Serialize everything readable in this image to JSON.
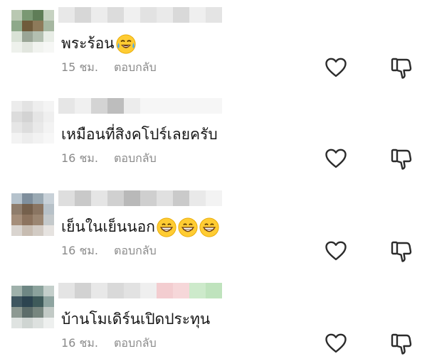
{
  "comments": [
    {
      "author": "",
      "text": "พระร้อน",
      "emoji": [
        "tears-of-joy-emoji"
      ],
      "time": "15 ชม.",
      "reply_label": "ตอบกลับ",
      "avatar_colors": [
        "#b9c8b2",
        "#7a9873",
        "#5f7d57",
        "#c6d2c1",
        "#8ea98a",
        "#6f5b3b",
        "#8d7a5a",
        "#a6b7a1",
        "#d9e2d6",
        "#9aa596",
        "#b3bfb0",
        "#e8ede6",
        "#eef1ec",
        "#e2e6df",
        "#f1f3ef",
        "#f6f7f5"
      ],
      "name_blur": [
        "#e8e8e8",
        "#d7d7d7",
        "#ececec",
        "#dcdcdc",
        "#f0f0f0",
        "#e2e2e2",
        "#eaeaea",
        "#d9d9d9",
        "#efefef",
        "#e4e4e4"
      ]
    },
    {
      "author": "",
      "text": "เหมือนที่สิงคโปร์เลยครับ",
      "emoji": [],
      "time": "16 ชม.",
      "reply_label": "ตอบกลับ",
      "avatar_colors": [
        "#ececec",
        "#e3e3e3",
        "#eeeeee",
        "#f4f4f4",
        "#dcdcdc",
        "#d3d3d3",
        "#e5e5e5",
        "#efefef",
        "#e6e6e6",
        "#dddddd",
        "#e9e9e9",
        "#f3f3f3",
        "#f3f3f3",
        "#ededed",
        "#f2f2f2",
        "#f7f7f7"
      ],
      "name_blur": [
        "#e6e6e6",
        "#f0f0f0",
        "#d4d4d4",
        "#bdbdbd",
        "#ececec",
        "#f6f6f6",
        "#f6f6f6",
        "#f6f6f6",
        "#f6f6f6",
        "#f6f6f6"
      ]
    },
    {
      "author": "",
      "text": "เย็นในเย็นนอก",
      "emoji": [
        "grinning-emoji",
        "grinning-emoji",
        "grinning-emoji"
      ],
      "time": "16 ชม.",
      "reply_label": "ตอบกลับ",
      "avatar_colors": [
        "#b5c2cc",
        "#7f8f9d",
        "#9aa9b3",
        "#c8d1d8",
        "#8f7d6c",
        "#75604c",
        "#8a7562",
        "#b7c1c8",
        "#a58e7a",
        "#8c735e",
        "#9b8672",
        "#c4c9cb",
        "#d9d4cf",
        "#c7bcb1",
        "#d2cbc4",
        "#e6e3e0"
      ],
      "name_blur": [
        "#dedede",
        "#c9c9c9",
        "#e5e5e5",
        "#d0d0d0",
        "#b9b9b9",
        "#cfcfcf",
        "#e0e0e0",
        "#cacaca",
        "#e9e9e9",
        "#f3f3f3"
      ]
    },
    {
      "author": "",
      "text": "บ้านโมเดิร์นเปิดประทุน",
      "emoji": [],
      "time": "16 ชม.",
      "reply_label": "ตอบกลับ",
      "avatar_colors": [
        "#9fb1ab",
        "#6e8784",
        "#8ba29c",
        "#c4cfcb",
        "#3f5660",
        "#2c4450",
        "#3e5a5a",
        "#8ea4a0",
        "#8d9992",
        "#5d6d6a",
        "#77867f",
        "#c2cac6",
        "#dfe3e1",
        "#cfd5d2",
        "#dde1df",
        "#eef0ef"
      ],
      "name_blur": [
        "#e4e4e4",
        "#d2d2d2",
        "#e8e8e8",
        "#d9d9d9",
        "#e2e2e2",
        "#efefef",
        "#f3cdd0",
        "#f6d7d9",
        "#cdeacb",
        "#bfe3bd"
      ]
    }
  ],
  "colors": {
    "text": "#161616",
    "meta": "#8a8a8a",
    "icon": "#2b2b2b"
  },
  "icons": {
    "like": "heart-outline-icon",
    "dislike": "thumbs-down-outline-icon"
  }
}
